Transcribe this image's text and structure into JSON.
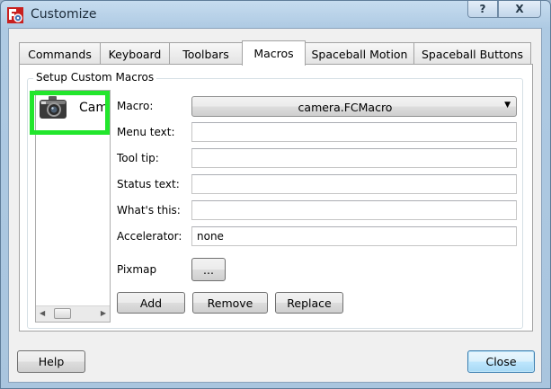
{
  "window": {
    "title": "Customize",
    "help_button": "?",
    "close_button": "X"
  },
  "tabs": [
    {
      "label": "Commands"
    },
    {
      "label": "Keyboard"
    },
    {
      "label": "Toolbars"
    },
    {
      "label": "Macros",
      "active": true
    },
    {
      "label": "Spaceball Motion"
    },
    {
      "label": "Spaceball Buttons"
    }
  ],
  "group": {
    "title": "Setup Custom Macros"
  },
  "macro_list": {
    "items": [
      {
        "label": "Cam",
        "icon": "camera-icon"
      }
    ],
    "scroll_left": "◀",
    "scroll_right": "▶"
  },
  "form": {
    "macro_label": "Macro:",
    "macro_value": "camera.FCMacro",
    "combo_arrow": "▼",
    "menu_text_label": "Menu text:",
    "menu_text_value": "",
    "tool_tip_label": "Tool tip:",
    "tool_tip_value": "",
    "status_text_label": "Status text:",
    "status_text_value": "",
    "whats_this_label": "What's this:",
    "whats_this_value": "",
    "accelerator_label": "Accelerator:",
    "accelerator_value": "none",
    "pixmap_label": "Pixmap",
    "pixmap_button": "..."
  },
  "actions": {
    "add": "Add",
    "remove": "Remove",
    "replace": "Replace"
  },
  "footer": {
    "help": "Help",
    "close": "Close"
  },
  "colors": {
    "highlight_box": "#22e62c",
    "titlebar": "#aecae3"
  }
}
